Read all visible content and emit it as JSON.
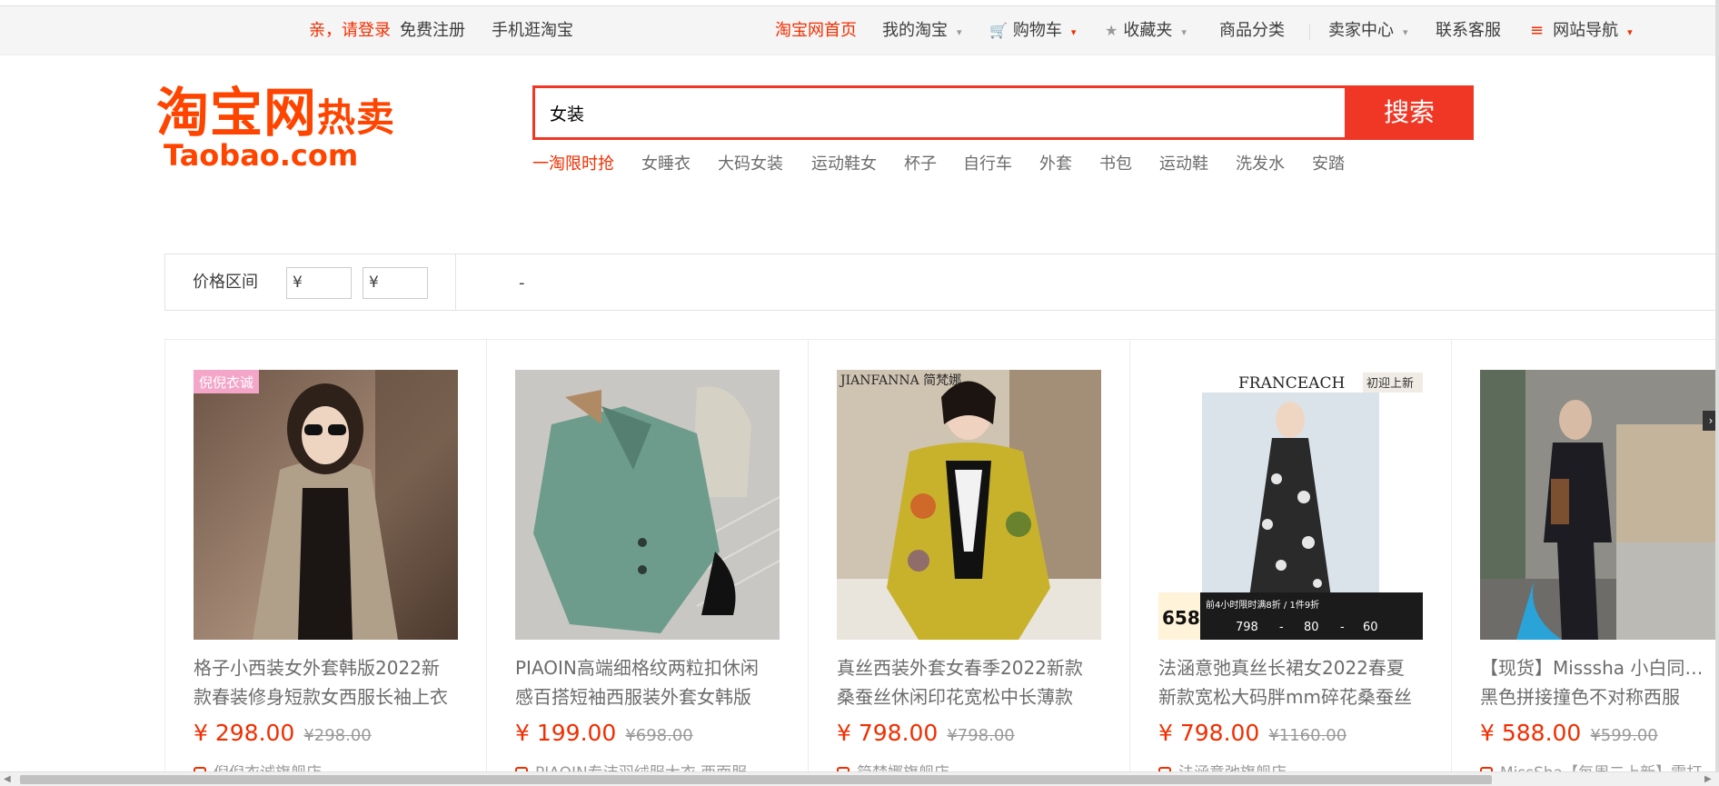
{
  "topbar": {
    "login": "亲，请登录",
    "register": "免费注册",
    "mobile": "手机逛淘宝",
    "home": "淘宝网首页",
    "my_taobao": "我的淘宝",
    "cart": "购物车",
    "favorites": "收藏夹",
    "categories": "商品分类",
    "seller_center": "卖家中心",
    "customer_service": "联系客服",
    "site_nav": "网站导航"
  },
  "logo": {
    "brand": "淘宝网",
    "sub": "热卖",
    "domain": "Taobao.com"
  },
  "search": {
    "value": "女装",
    "button": "搜索"
  },
  "hotwords": [
    "一淘限时抢",
    "女睡衣",
    "大码女装",
    "运动鞋女",
    "杯子",
    "自行车",
    "外套",
    "书包",
    "运动鞋",
    "洗发水",
    "安踏"
  ],
  "filter": {
    "label": "价格区间",
    "min_placeholder": "¥",
    "max_placeholder": "¥",
    "dash": "-"
  },
  "products": [
    {
      "title_line1": "格子小西装女外套韩版2022新",
      "title_line2": "款春装修身短款女西服长袖上衣",
      "price": "¥ 298.00",
      "old_price": "¥298.00",
      "shop": "倪倪衣诚旗舰店",
      "badge": "倪倪衣诚"
    },
    {
      "title_line1": "PIAOIN高端细格纹两粒扣休闲",
      "title_line2": "感百搭短袖西服装外套女韩版",
      "price": "¥ 199.00",
      "old_price": "¥698.00",
      "shop": "PIAOIN专洁羽绒服大衣 西面服"
    },
    {
      "title_line1": "真丝西装外套女春季2022新款",
      "title_line2": "桑蚕丝休闲印花宽松中长薄款",
      "price": "¥ 798.00",
      "old_price": "¥798.00",
      "shop": "简梵娜旗舰店",
      "badge": "JIANFANNA 简梵娜"
    },
    {
      "title_line1": "法涵意弛真丝长裙女2022春夏",
      "title_line2": "新款宽松大码胖mm碎花桑蚕丝",
      "price": "¥ 798.00",
      "old_price": "¥1160.00",
      "shop": "法涵意弛旗舰店",
      "badge": "FRANCEACH",
      "tag": "初迎上新",
      "promo_price": "658",
      "promo_text": "前4小时限时满8折 / 1件9折",
      "promo_row": [
        "798",
        "-",
        "80",
        "-",
        "60"
      ]
    },
    {
      "title_line1": "【现货】Misssha 小白同款卡其",
      "title_line2": "黑色拼接撞色不对称西服",
      "price": "¥ 588.00",
      "old_price": "¥599.00",
      "shop": "MissSha【每周二上新】雷打"
    }
  ]
}
